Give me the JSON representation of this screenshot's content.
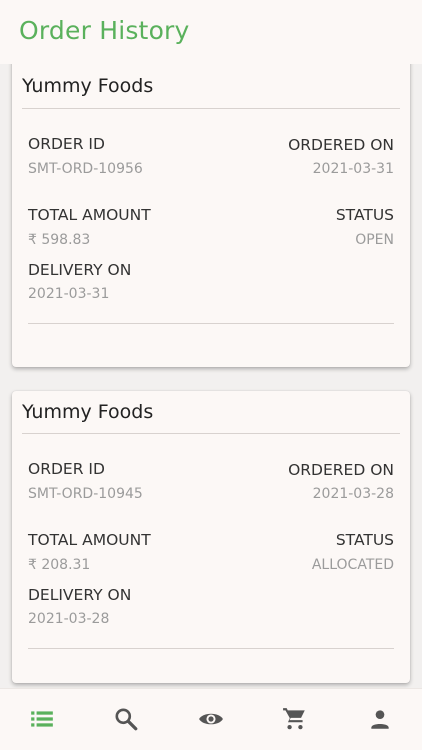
{
  "header": {
    "title": "Order History"
  },
  "labels": {
    "order_id": "ORDER ID",
    "ordered_on": "ORDERED ON",
    "total_amount": "TOTAL AMOUNT",
    "status": "STATUS",
    "delivery_on": "DELIVERY ON"
  },
  "orders": [
    {
      "restaurant": "Yummy Foods",
      "order_id": "SMT-ORD-10956",
      "ordered_on": "2021-03-31",
      "total_amount": "₹ 598.83",
      "status": "OPEN",
      "delivery_on": "2021-03-31"
    },
    {
      "restaurant": "Yummy Foods",
      "order_id": "SMT-ORD-10945",
      "ordered_on": "2021-03-28",
      "total_amount": "₹ 208.31",
      "status": "ALLOCATED",
      "delivery_on": "2021-03-28"
    }
  ],
  "bottom_nav": {
    "items": [
      {
        "icon": "list-icon",
        "active": true
      },
      {
        "icon": "search-icon",
        "active": false
      },
      {
        "icon": "eye-icon",
        "active": false
      },
      {
        "icon": "cart-icon",
        "active": false
      },
      {
        "icon": "person-icon",
        "active": false
      }
    ]
  },
  "colors": {
    "accent": "#5ab15c",
    "icon_inactive": "#555555",
    "value_text": "#9b9b9b"
  }
}
